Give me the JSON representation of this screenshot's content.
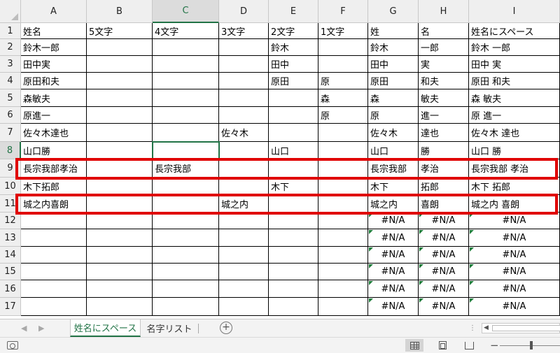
{
  "columns": [
    "A",
    "B",
    "C",
    "D",
    "E",
    "F",
    "G",
    "H",
    "I"
  ],
  "selected_column": "C",
  "selected_row": 8,
  "active_cell": "C8",
  "rows": [
    {
      "n": 1,
      "cells": [
        "姓名",
        "5文字",
        "4文字",
        "3文字",
        "2文字",
        "1文字",
        "姓",
        "名",
        "姓名にスペース"
      ]
    },
    {
      "n": 2,
      "cells": [
        "鈴木一郎",
        "",
        "",
        "",
        "鈴木",
        "",
        "鈴木",
        "一郎",
        "鈴木 一郎"
      ]
    },
    {
      "n": 3,
      "cells": [
        "田中実",
        "",
        "",
        "",
        "田中",
        "",
        "田中",
        "実",
        "田中 実"
      ]
    },
    {
      "n": 4,
      "cells": [
        "原田和夫",
        "",
        "",
        "",
        "原田",
        "原",
        "原田",
        "和夫",
        "原田 和夫"
      ]
    },
    {
      "n": 5,
      "cells": [
        "森敏夫",
        "",
        "",
        "",
        "",
        "森",
        "森",
        "敏夫",
        "森 敏夫"
      ]
    },
    {
      "n": 6,
      "cells": [
        "原進一",
        "",
        "",
        "",
        "",
        "原",
        "原",
        "進一",
        "原 進一"
      ]
    },
    {
      "n": 7,
      "cells": [
        "佐々木達也",
        "",
        "",
        "佐々木",
        "",
        "",
        "佐々木",
        "達也",
        "佐々木 達也"
      ]
    },
    {
      "n": 8,
      "cells": [
        "山口勝",
        "",
        "",
        "",
        "山口",
        "",
        "山口",
        "勝",
        "山口 勝"
      ]
    },
    {
      "n": 9,
      "cells": [
        "長宗我部孝治",
        "",
        "長宗我部",
        "",
        "",
        "",
        "長宗我部",
        "孝治",
        "長宗我部 孝治"
      ]
    },
    {
      "n": 10,
      "cells": [
        "木下拓郎",
        "",
        "",
        "",
        "木下",
        "",
        "木下",
        "拓郎",
        "木下 拓郎"
      ]
    },
    {
      "n": 11,
      "cells": [
        "城之内喜朗",
        "",
        "",
        "城之内",
        "",
        "",
        "城之内",
        "喜朗",
        "城之内 喜朗"
      ]
    },
    {
      "n": 12,
      "cells": [
        "",
        "",
        "",
        "",
        "",
        "",
        "#N/A",
        "#N/A",
        "#N/A"
      ]
    },
    {
      "n": 13,
      "cells": [
        "",
        "",
        "",
        "",
        "",
        "",
        "#N/A",
        "#N/A",
        "#N/A"
      ]
    },
    {
      "n": 14,
      "cells": [
        "",
        "",
        "",
        "",
        "",
        "",
        "#N/A",
        "#N/A",
        "#N/A"
      ]
    },
    {
      "n": 15,
      "cells": [
        "",
        "",
        "",
        "",
        "",
        "",
        "#N/A",
        "#N/A",
        "#N/A"
      ]
    },
    {
      "n": 16,
      "cells": [
        "",
        "",
        "",
        "",
        "",
        "",
        "#N/A",
        "#N/A",
        "#N/A"
      ]
    },
    {
      "n": 17,
      "cells": [
        "",
        "",
        "",
        "",
        "",
        "",
        "#N/A",
        "#N/A",
        "#N/A"
      ]
    }
  ],
  "highlighted_rows": [
    9,
    11
  ],
  "highlight_color": "#e00000",
  "accent_color": "#217346",
  "sheet_tabs": [
    {
      "label": "姓名にスペース",
      "active": true
    },
    {
      "label": "名字リスト",
      "active": false
    }
  ],
  "tabbar": {
    "prev_icon": "triangle-left-icon",
    "next_icon": "triangle-right-icon",
    "add_sheet_label": "+",
    "ellipsis": "⋮"
  },
  "statusbar": {
    "macro_icon": "macro-record-icon",
    "views": [
      "normal-view-icon",
      "page-layout-view-icon",
      "page-break-view-icon"
    ],
    "active_view": "normal-view-icon",
    "zoom_minus": "−"
  }
}
